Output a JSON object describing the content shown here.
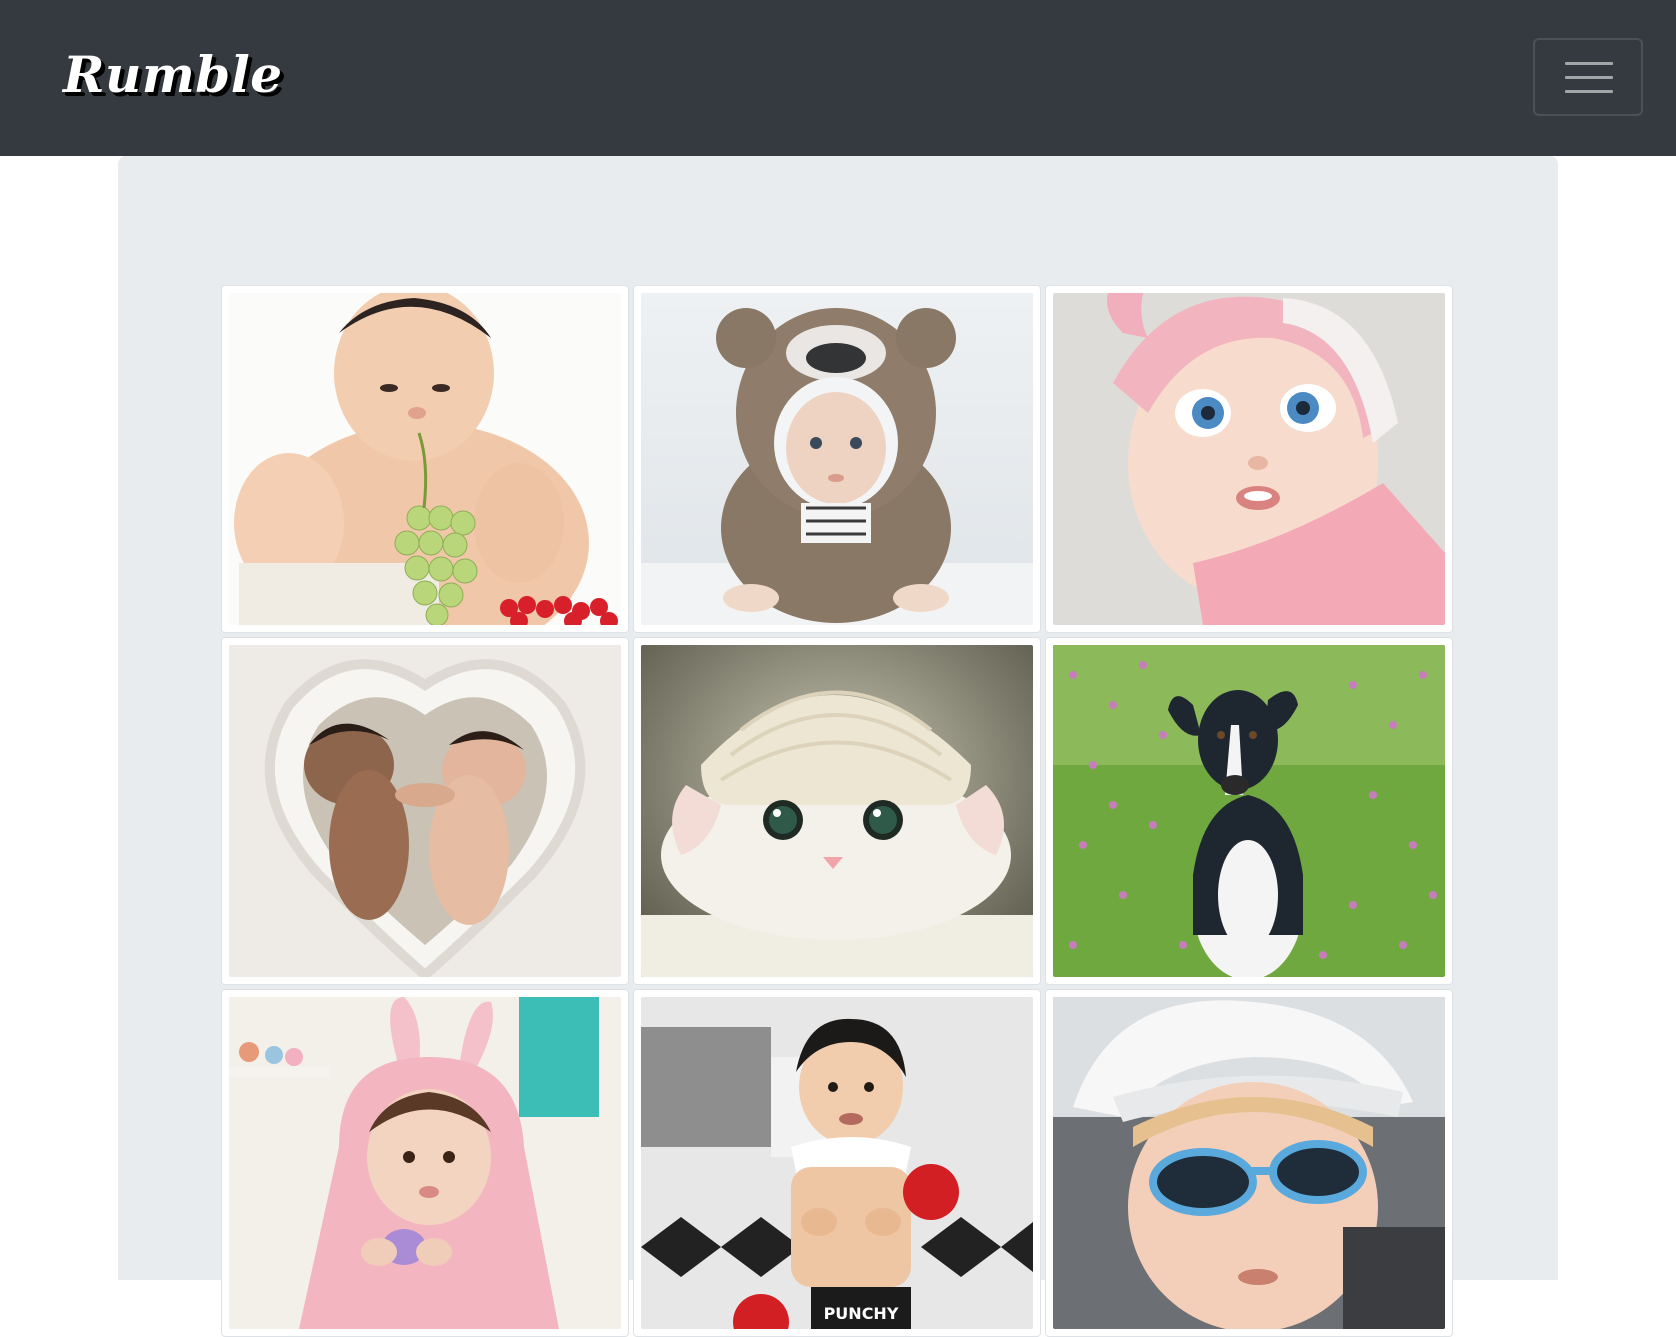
{
  "navbar": {
    "brand": "Rumble",
    "toggler_icon": "hamburger-menu-icon"
  },
  "gallery": {
    "items": [
      {
        "name": "photo-baby-with-grapes",
        "subject": "baby-with-grapes"
      },
      {
        "name": "photo-baby-in-bear-costume",
        "subject": "baby-in-bear-costume"
      },
      {
        "name": "photo-blue-eyed-baby-pink-hat",
        "subject": "blue-eyed-baby"
      },
      {
        "name": "photo-twin-newborns-in-blanket",
        "subject": "twin-newborns"
      },
      {
        "name": "photo-white-kitten-in-knit-hat",
        "subject": "kitten-in-hat"
      },
      {
        "name": "photo-dog-in-flower-field",
        "subject": "dog-in-field"
      },
      {
        "name": "photo-baby-in-bunny-towel",
        "subject": "baby-bunny-towel"
      },
      {
        "name": "photo-baby-boxer-costume",
        "subject": "baby-boxer"
      },
      {
        "name": "photo-baby-with-sunglasses",
        "subject": "baby-sunglasses"
      }
    ]
  },
  "colors": {
    "navbar_bg": "#343a40",
    "jumbotron_bg": "#e9ecef",
    "card_border": "#dee2e6"
  }
}
